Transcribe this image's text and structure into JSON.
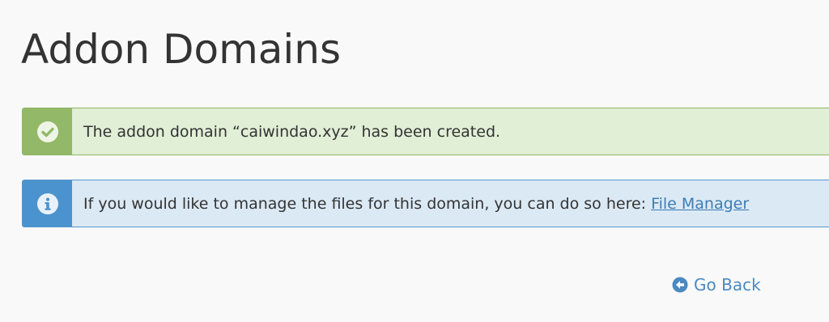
{
  "page": {
    "title": "Addon Domains"
  },
  "alerts": {
    "success": {
      "icon": "check-circle-icon",
      "message": "The addon domain “caiwindao.xyz” has been created."
    },
    "info": {
      "icon": "info-circle-icon",
      "message_prefix": "If you would like to manage the files for this domain, you can do so here:",
      "link_label": "File Manager"
    }
  },
  "navigation": {
    "go_back_icon": "arrow-circle-left-icon",
    "go_back_label": "Go Back"
  },
  "colors": {
    "success_icon_bg": "#92b868",
    "success_bg": "#e0efd6",
    "info_icon_bg": "#4a93cf",
    "info_bg": "#dbe9f5",
    "link": "#3e7db3"
  }
}
